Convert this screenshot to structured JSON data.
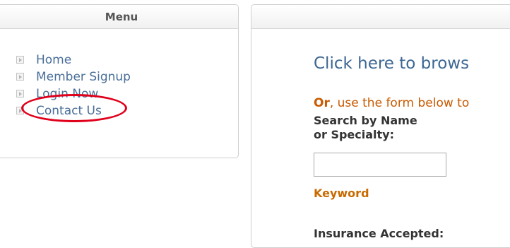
{
  "menu": {
    "title": "Menu",
    "items": [
      {
        "label": "Home"
      },
      {
        "label": "Member Signup"
      },
      {
        "label": "Login Now"
      },
      {
        "label": "Contact Us"
      }
    ]
  },
  "main": {
    "browse_link": "Click here to brows",
    "or_word": "Or",
    "or_text": ", use the form below to",
    "search_label_line1": "Search by Name",
    "search_label_line2": "or Specialty:",
    "keyword_value": "",
    "keyword_label": "Keyword",
    "insurance_label": "Insurance Accepted:"
  },
  "annotation": {
    "highlight_color": "#e0001b"
  }
}
